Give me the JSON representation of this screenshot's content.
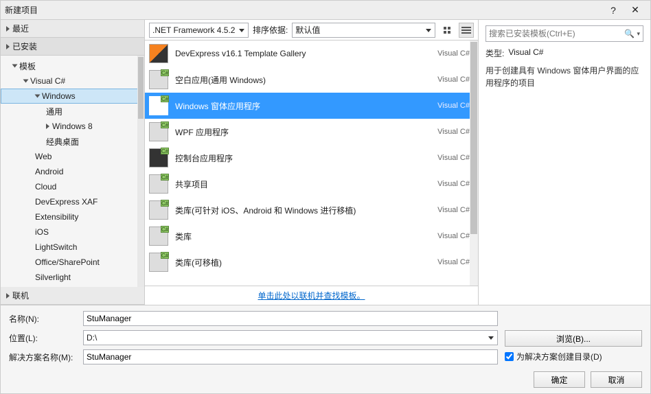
{
  "window": {
    "title": "新建项目"
  },
  "left": {
    "recent": "最近",
    "installed": "已安装",
    "online": "联机",
    "templates_root": "模板",
    "tree": {
      "csharp": "Visual C#",
      "windows": "Windows",
      "universal": "通用",
      "windows8": "Windows 8",
      "classic_desktop": "经典桌面",
      "web": "Web",
      "android": "Android",
      "cloud": "Cloud",
      "dxxaf": "DevExpress XAF",
      "extensibility": "Extensibility",
      "ios": "iOS",
      "lightswitch": "LightSwitch",
      "office": "Office/SharePoint",
      "silverlight": "Silverlight"
    }
  },
  "toolbar": {
    "framework": ".NET Framework 4.5.2",
    "sort_label": "排序依据:",
    "sort_value": "默认值"
  },
  "templates": [
    {
      "name": "DevExpress v16.1 Template Gallery",
      "lang": "Visual C#"
    },
    {
      "name": "空白应用(通用 Windows)",
      "lang": "Visual C#"
    },
    {
      "name": "Windows 窗体应用程序",
      "lang": "Visual C#",
      "selected": true
    },
    {
      "name": "WPF 应用程序",
      "lang": "Visual C#"
    },
    {
      "name": "控制台应用程序",
      "lang": "Visual C#"
    },
    {
      "name": "共享项目",
      "lang": "Visual C#"
    },
    {
      "name": "类库(可针对 iOS、Android 和 Windows 进行移植)",
      "lang": "Visual C#"
    },
    {
      "name": "类库",
      "lang": "Visual C#"
    },
    {
      "name": "类库(可移植)",
      "lang": "Visual C#"
    }
  ],
  "online_link": "单击此处以联机并查找模板。",
  "right": {
    "search_placeholder": "搜索已安装模板(Ctrl+E)",
    "type_label": "类型:",
    "type_value": "Visual C#",
    "description": "用于创建具有 Windows 窗体用户界面的应用程序的项目"
  },
  "bottom": {
    "name_label": "名称(N):",
    "name_value": "StuManager",
    "location_label": "位置(L):",
    "location_value": "D:\\",
    "solution_label": "解决方案名称(M):",
    "solution_value": "StuManager",
    "browse": "浏览(B)...",
    "checkbox": "为解决方案创建目录(D)",
    "ok": "确定",
    "cancel": "取消"
  }
}
